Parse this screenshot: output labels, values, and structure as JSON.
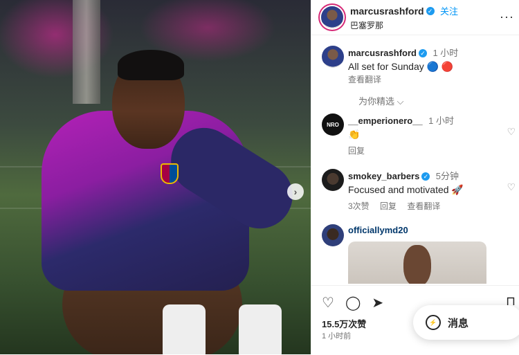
{
  "post": {
    "author": "marcusrashford",
    "follow_label": "关注",
    "location": "巴塞罗那",
    "more_label": "···"
  },
  "caption": {
    "author": "marcusrashford",
    "time": "1 小时",
    "text": "All set for Sunday 🔵 🔴",
    "translate_label": "查看翻译"
  },
  "sort_label": "为你精选 ⌵",
  "comments": [
    {
      "user": "__emperionero__",
      "time": "1 小时",
      "text": "👏",
      "actions": [
        "回复"
      ],
      "avatar_text": "NRO"
    },
    {
      "user": "smokey_barbers",
      "time": "5分钟",
      "text": "Focused and motivated 🚀",
      "actions": [
        "3次赞",
        "回复",
        "查看翻译"
      ]
    },
    {
      "user": "officiallymd20",
      "time": "",
      "text": "",
      "actions": []
    }
  ],
  "stats": {
    "views": "15.5万次赞",
    "posted_ago": "1 小时前"
  },
  "messages_label": "消息",
  "icons": {
    "verified": "✓",
    "heart": "♡",
    "comment": "◯",
    "share": "➤",
    "bookmark": "⊓",
    "next": "›",
    "message": "⚡"
  }
}
